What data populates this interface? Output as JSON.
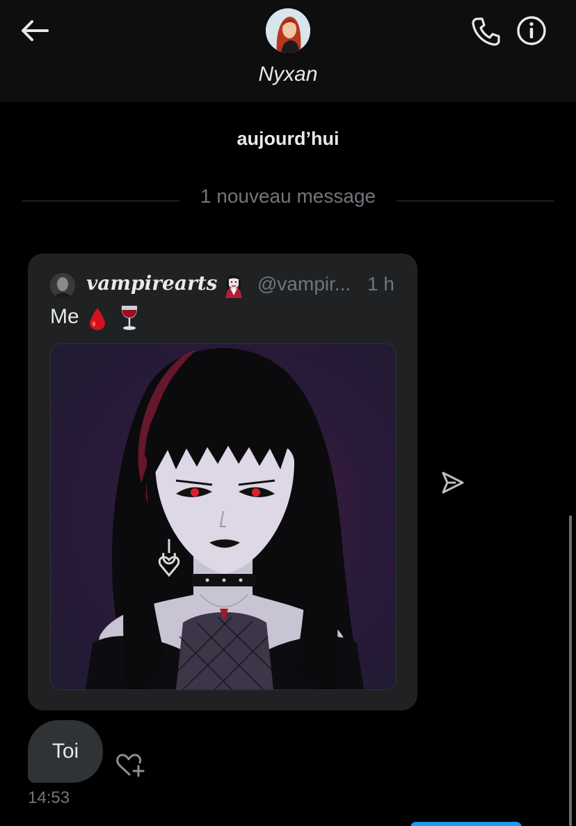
{
  "header": {
    "back_icon": "arrow-left-icon",
    "contact_name": "Nyxan",
    "call_icon": "phone-icon",
    "info_icon": "info-icon"
  },
  "conversation": {
    "date_label": "aujourd’hui",
    "new_messages_label": "1 nouveau message"
  },
  "shared_tweet": {
    "author": "vampirearts",
    "author_emoji": "vampire-emoji",
    "handle": "@vampir...",
    "time": "1 h",
    "text": "Me",
    "text_emojis": [
      "drop-of-blood-emoji",
      "wine-glass-emoji"
    ],
    "share_icon": "send-icon"
  },
  "message": {
    "text": "Toi",
    "time": "14:53",
    "reaction_icon": "add-reaction-icon"
  },
  "colors": {
    "background": "#000000",
    "header": "#0e0e0f",
    "card": "#1f2123",
    "bubble": "#2f3336",
    "muted_text": "#71767b",
    "accent": "#1d9bf0"
  }
}
